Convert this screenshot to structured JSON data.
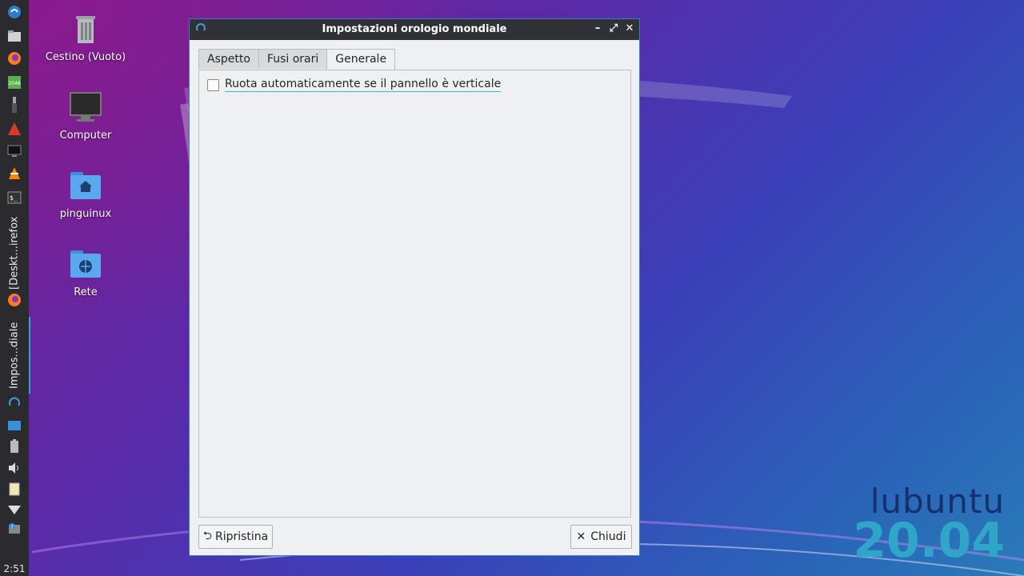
{
  "desktop": {
    "icons": [
      {
        "label": "Cestino (Vuoto)",
        "icon": "trash-icon"
      },
      {
        "label": "Computer",
        "icon": "computer-icon"
      },
      {
        "label": "pinguinux",
        "icon": "home-folder-icon"
      },
      {
        "label": "Rete",
        "icon": "network-folder-icon"
      }
    ],
    "branding": {
      "name": "lubuntu",
      "version": "20.04"
    }
  },
  "panel": {
    "launchers": [
      "lubuntu-menu-icon",
      "file-manager-icon",
      "firefox-icon",
      "game-2048-icon",
      "usb-icon",
      "app-icon",
      "monitor-icon",
      "vlc-icon",
      "terminal-icon"
    ],
    "tasks": [
      {
        "label": "[Deskt...irefox",
        "icon": "firefox-icon",
        "active": false
      },
      {
        "label": "Impos...diale",
        "icon": "clock-settings-icon",
        "active": true
      }
    ],
    "tray": [
      "desktop-icon",
      "battery-icon",
      "volume-icon",
      "clipboard-icon",
      "wifi-icon",
      "update-notifier-icon"
    ],
    "clock": "2:51"
  },
  "window": {
    "title": "Impostazioni orologio mondiale",
    "tabs": [
      {
        "label": "Aspetto",
        "active": false
      },
      {
        "label": "Fusi orari",
        "active": false
      },
      {
        "label": "Generale",
        "active": true
      }
    ],
    "general": {
      "rotate_checkbox_label": "Ruota automaticamente se il pannello è verticale",
      "rotate_checked": false
    },
    "buttons": {
      "reset_label": "Ripristina",
      "close_label": "Chiudi"
    }
  },
  "colors": {
    "panel_bg": "#2b2b2f",
    "titlebar_bg": "#2f3136",
    "accent": "#3daee9"
  }
}
